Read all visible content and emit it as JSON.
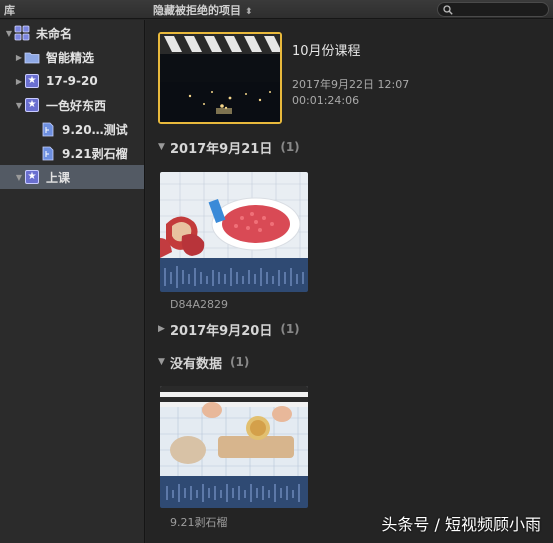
{
  "header": {
    "library_label": "库",
    "filter_label": "隐藏被拒绝的项目",
    "filter_arrow": "⬍"
  },
  "sidebar": {
    "items": [
      {
        "label": "未命名",
        "icon": "library-icon",
        "expanded": true,
        "level": 0
      },
      {
        "label": "智能精选",
        "icon": "folder-icon",
        "expanded": false,
        "level": 1
      },
      {
        "label": "17-9-20",
        "icon": "event-star-icon",
        "expanded": false,
        "level": 1
      },
      {
        "label": "一色好东西",
        "icon": "event-star-icon",
        "expanded": true,
        "level": 1
      },
      {
        "label": "9.20…测试",
        "icon": "project-icon",
        "level": 2
      },
      {
        "label": "9.21剥石榴",
        "icon": "project-icon",
        "level": 2
      },
      {
        "label": "上课",
        "icon": "event-star-icon",
        "expanded": false,
        "level": 1,
        "selected": true
      }
    ]
  },
  "browser": {
    "project": {
      "title": "10月份课程",
      "date": "2017年9月22日 12:07",
      "duration": "00:01:24:06"
    },
    "sections": [
      {
        "name": "2017年9月21日",
        "count": "(1)",
        "expanded": true,
        "clip": "D84A2829"
      },
      {
        "name": "2017年9月20日",
        "count": "(1)",
        "expanded": false
      },
      {
        "name": "没有数据",
        "count": "(1)",
        "expanded": true,
        "clip": "9.21剥石榴"
      }
    ]
  },
  "watermark": "头条号 / 短视频顾小雨",
  "colors": {
    "selection": "#535a64",
    "selected_thumb_border": "#e8b93c",
    "waveform": "#2f4a73"
  }
}
